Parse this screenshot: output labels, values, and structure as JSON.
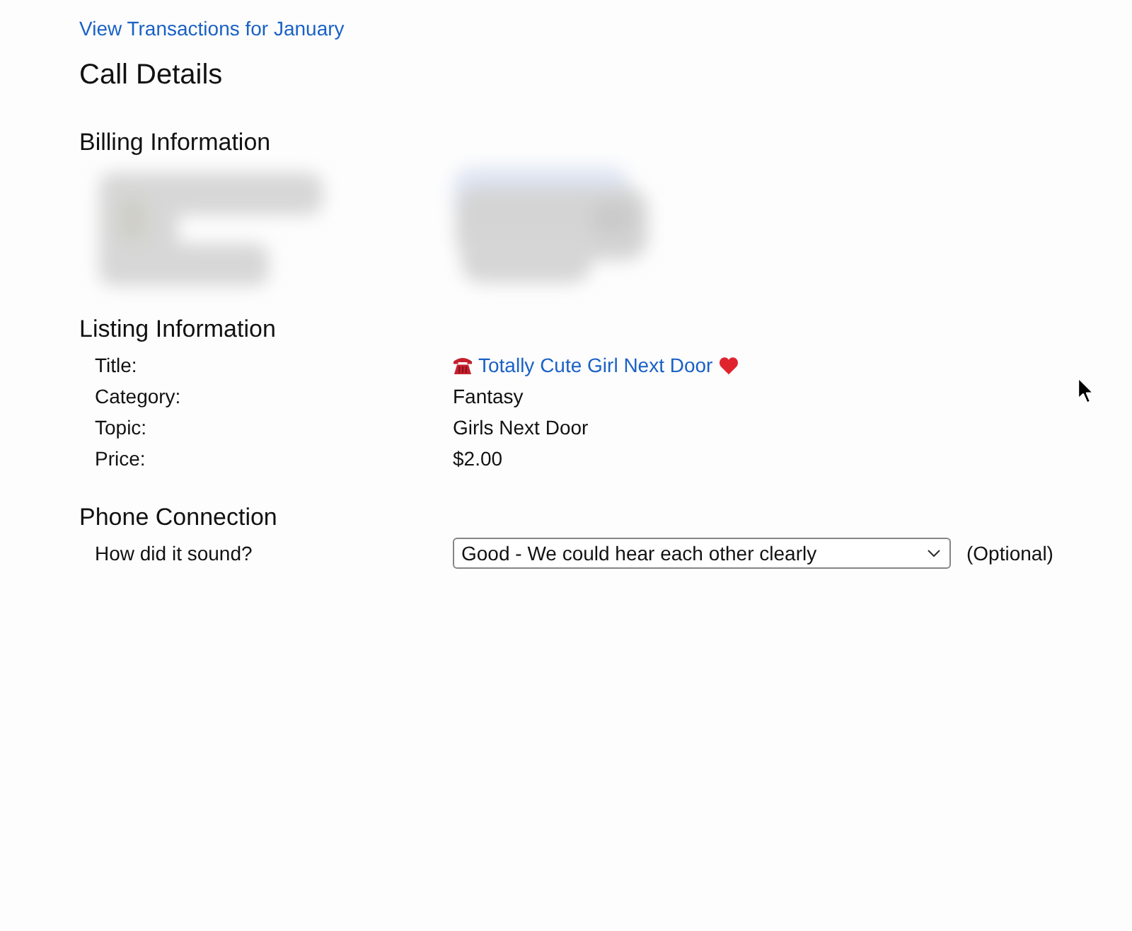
{
  "top_link": {
    "label": "View Transactions for January"
  },
  "title": "Call Details",
  "billing": {
    "heading": "Billing Information"
  },
  "listing": {
    "heading": "Listing Information",
    "fields": [
      {
        "label": "Title:",
        "value": "Totally Cute Girl Next Door",
        "kind": "link"
      },
      {
        "label": "Category:",
        "value": "Fantasy",
        "kind": "text"
      },
      {
        "label": "Topic:",
        "value": "Girls Next Door",
        "kind": "text"
      },
      {
        "label": "Price:",
        "value": "$2.00",
        "kind": "text"
      }
    ]
  },
  "phone_connection": {
    "heading": "Phone Connection",
    "question": "How did it sound?",
    "select": {
      "value": "Good - We could hear each other clearly"
    },
    "note": "(Optional)"
  }
}
